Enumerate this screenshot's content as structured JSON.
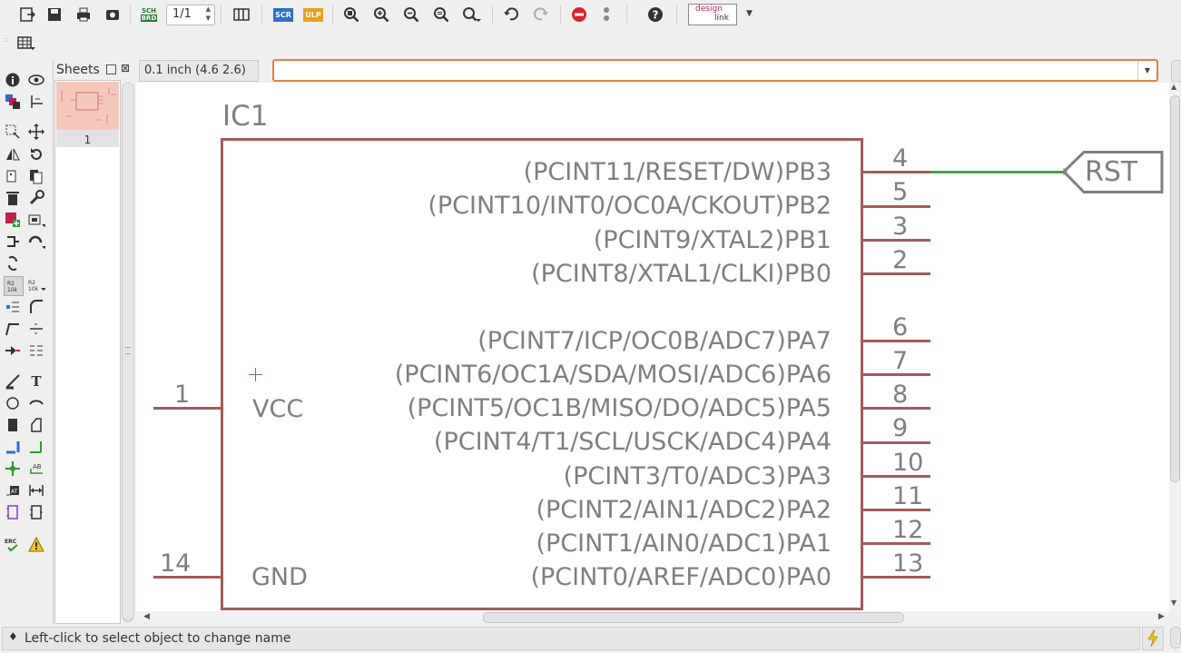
{
  "toolbar": {
    "sheet_spinner_value": "1/1",
    "scr_label": "SCR",
    "ulp_label": "ULP",
    "sch_brd_top": "SCH",
    "sch_brd_bottom": "BRD",
    "designlink_top": "design",
    "designlink_bottom": "link"
  },
  "sheets_panel": {
    "title": "Sheets",
    "sheet_number": "1"
  },
  "coordinate_display": "0.1 inch (4.6 2.6)",
  "command_input": {
    "value": ""
  },
  "schematic": {
    "part_name": "IC1",
    "vcc_label": "VCC",
    "gnd_label": "GND",
    "right_pins": [
      {
        "label": "(PCINT11/RESET/DW)PB3",
        "num": "4"
      },
      {
        "label": "(PCINT10/INT0/OC0A/CKOUT)PB2",
        "num": "5"
      },
      {
        "label": "(PCINT9/XTAL2)PB1",
        "num": "3"
      },
      {
        "label": "(PCINT8/XTAL1/CLKI)PB0",
        "num": "2"
      },
      {
        "label": "(PCINT7/ICP/OC0B/ADC7)PA7",
        "num": "6"
      },
      {
        "label": "(PCINT6/OC1A/SDA/MOSI/ADC6)PA6",
        "num": "7"
      },
      {
        "label": "(PCINT5/OC1B/MISO/DO/ADC5)PA5",
        "num": "8"
      },
      {
        "label": "(PCINT4/T1/SCL/USCK/ADC4)PA4",
        "num": "9"
      },
      {
        "label": "(PCINT3/T0/ADC3)PA3",
        "num": "10"
      },
      {
        "label": "(PCINT2/AIN1/ADC2)PA2",
        "num": "11"
      },
      {
        "label": "(PCINT1/AIN0/ADC1)PA1",
        "num": "12"
      },
      {
        "label": "(PCINT0/AREF/ADC0)PA0",
        "num": "13"
      }
    ],
    "left_pins": [
      {
        "num": "1"
      },
      {
        "num": "14"
      }
    ],
    "net_label": "RST"
  },
  "status_bar": {
    "message": "Left-click to select object to change name"
  },
  "colors": {
    "symbol_outline": "#a45b5b",
    "text": "#7f7f7f",
    "net": "#4aa04a",
    "label_border": "#808080",
    "command_border": "#e8803a"
  }
}
